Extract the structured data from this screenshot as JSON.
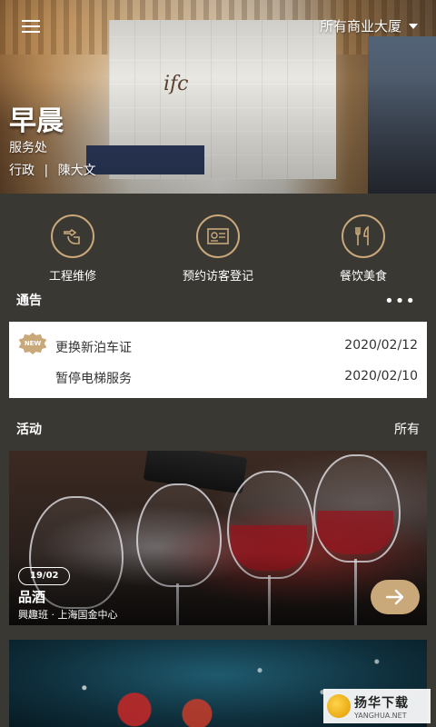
{
  "header": {
    "building_selector": "所有商业大厦",
    "greeting": "早晨",
    "office": "服务处",
    "department": "行政",
    "divider": "|",
    "user_name": "陳大文"
  },
  "quick_actions": [
    {
      "label": "工程维修",
      "icon": "wrench-hand-icon"
    },
    {
      "label": "预约访客登记",
      "icon": "visitor-card-icon"
    },
    {
      "label": "餐饮美食",
      "icon": "fork-knife-icon"
    }
  ],
  "notices": {
    "title": "通告",
    "more": "•••",
    "items": [
      {
        "badge": "NEW",
        "title": "更换新泊车证",
        "date": "2020/02/12"
      },
      {
        "title": "暂停电梯服务",
        "date": "2020/02/10"
      }
    ]
  },
  "activities": {
    "title": "活动",
    "all_label": "所有",
    "cards": [
      {
        "date": "19/02",
        "title": "品酒",
        "subtitle": "興趣班 · 上海国金中心"
      }
    ]
  },
  "watermark": {
    "main": "扬华下载",
    "sub": "YANGHUA.NET"
  },
  "colors": {
    "accent": "#c9a87a",
    "background": "#3a3833"
  }
}
